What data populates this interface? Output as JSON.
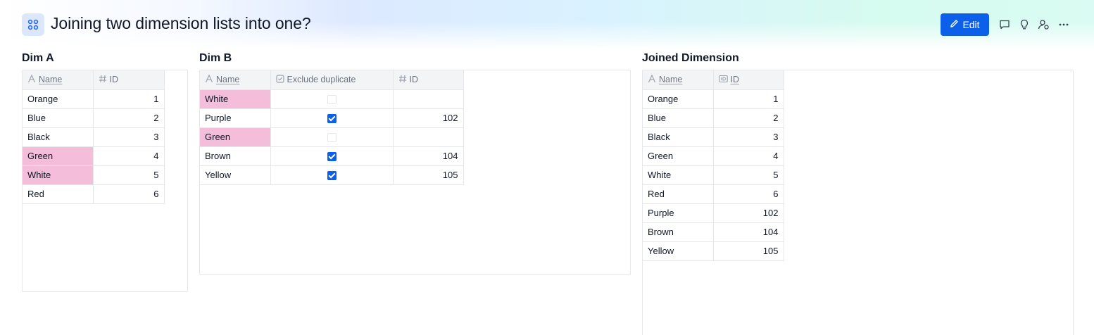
{
  "page": {
    "title": "Joining two dimension lists into one?",
    "app_icon": "grid-icon"
  },
  "toolbar": {
    "edit_label": "Edit",
    "icons": [
      "comment-icon",
      "lightbulb-icon",
      "user-settings-icon",
      "more-icon"
    ]
  },
  "colors": {
    "accent": "#0b5fe8",
    "highlight": "#f4bdd9"
  },
  "dim_a": {
    "title": "Dim A",
    "columns": [
      {
        "label": "Name",
        "icon": "text-icon"
      },
      {
        "label": "ID",
        "icon": "hash-icon"
      }
    ],
    "rows": [
      {
        "name": "Orange",
        "id": "1",
        "highlight": false
      },
      {
        "name": "Blue",
        "id": "2",
        "highlight": false
      },
      {
        "name": "Black",
        "id": "3",
        "highlight": false
      },
      {
        "name": "Green",
        "id": "4",
        "highlight": true
      },
      {
        "name": "White",
        "id": "5",
        "highlight": true
      },
      {
        "name": "Red",
        "id": "6",
        "highlight": false
      }
    ]
  },
  "dim_b": {
    "title": "Dim B",
    "columns": [
      {
        "label": "Name",
        "icon": "text-icon"
      },
      {
        "label": "Exclude duplicate",
        "icon": "checkbox-icon"
      },
      {
        "label": "ID",
        "icon": "hash-icon"
      }
    ],
    "rows": [
      {
        "name": "White",
        "exclude": false,
        "id": "",
        "highlight": true
      },
      {
        "name": "Purple",
        "exclude": true,
        "id": "102",
        "highlight": false
      },
      {
        "name": "Green",
        "exclude": false,
        "id": "",
        "highlight": true
      },
      {
        "name": "Brown",
        "exclude": true,
        "id": "104",
        "highlight": false
      },
      {
        "name": "Yellow",
        "exclude": true,
        "id": "105",
        "highlight": false
      }
    ]
  },
  "joined": {
    "title": "Joined Dimension",
    "columns": [
      {
        "label": "Name",
        "icon": "text-icon"
      },
      {
        "label": "ID",
        "icon": "id-icon"
      }
    ],
    "rows": [
      {
        "name": "Orange",
        "id": "1"
      },
      {
        "name": "Blue",
        "id": "2"
      },
      {
        "name": "Black",
        "id": "3"
      },
      {
        "name": "Green",
        "id": "4"
      },
      {
        "name": "White",
        "id": "5"
      },
      {
        "name": "Red",
        "id": "6"
      },
      {
        "name": "Purple",
        "id": "102"
      },
      {
        "name": "Brown",
        "id": "104"
      },
      {
        "name": "Yellow",
        "id": "105"
      }
    ]
  }
}
